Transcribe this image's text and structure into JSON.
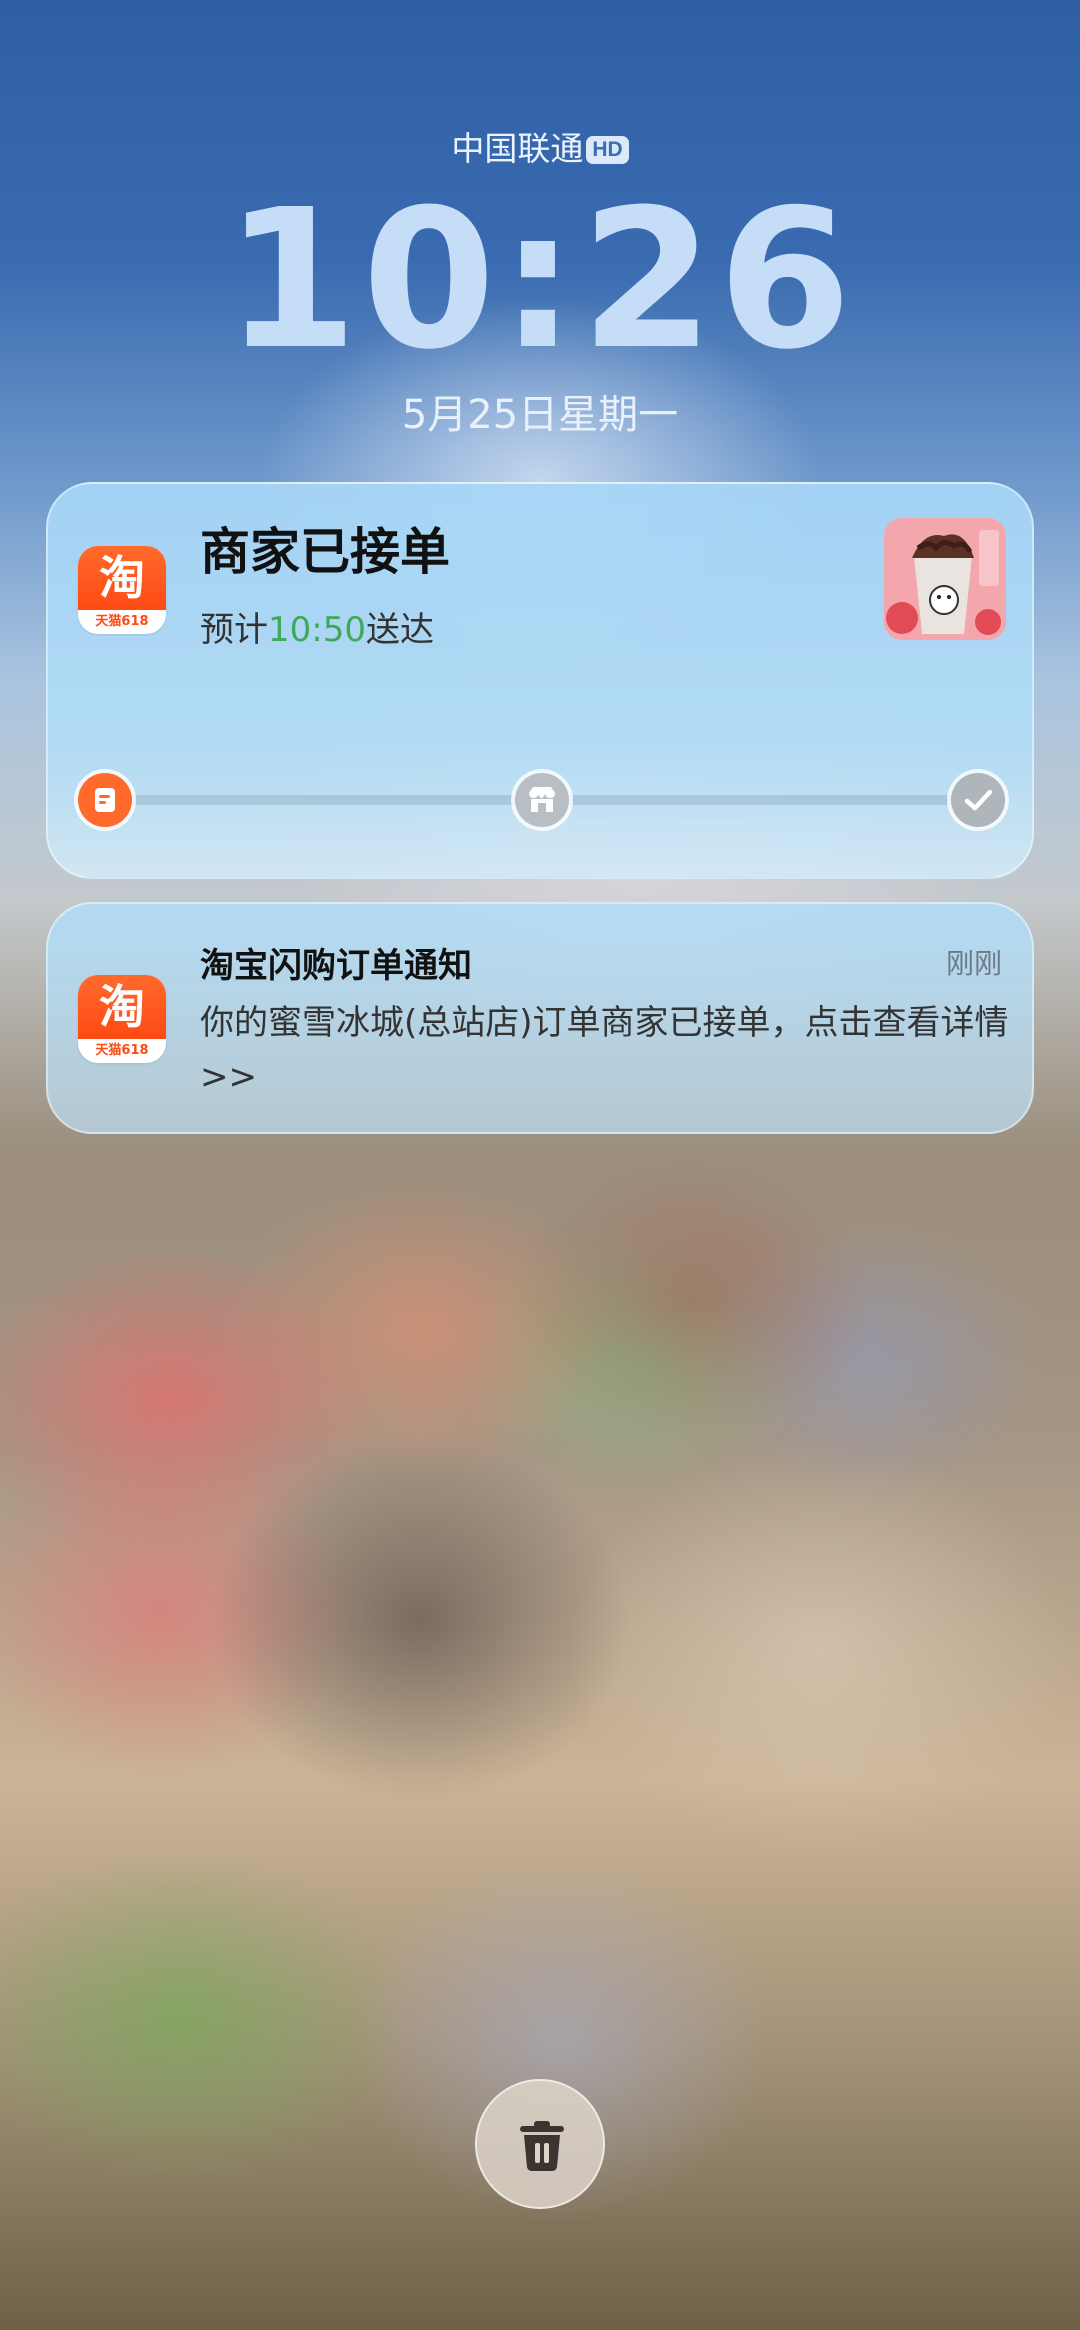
{
  "status": {
    "carrier": "中国联通",
    "network_badge": "HD"
  },
  "lockscreen": {
    "time": "10:26",
    "date": "5月25日星期一"
  },
  "live_activity": {
    "app_icon": {
      "glyph": "淘",
      "caption": "天猫618",
      "name": "taobao-icon"
    },
    "title": "商家已接单",
    "subtitle_prefix": "预计",
    "eta": "10:50",
    "subtitle_suffix": "送达",
    "product_thumb_icon": "ice-cream-drink-thumbnail",
    "progress": {
      "steps": [
        {
          "icon": "order-icon",
          "state": "done"
        },
        {
          "icon": "store-icon",
          "state": "pending"
        },
        {
          "icon": "check-icon",
          "state": "pending"
        }
      ],
      "fraction": 0.0
    },
    "accent_color": "#ff6a2c",
    "eta_color": "#3fa85a"
  },
  "notification": {
    "app_icon": {
      "glyph": "淘",
      "caption": "天猫618",
      "name": "taobao-icon"
    },
    "title": "淘宝闪购订单通知",
    "time": "刚刚",
    "body": "你的蜜雪冰城(总站店)订单商家已接单，点击查看详情>>"
  },
  "actions": {
    "clear_icon": "trash-icon"
  }
}
